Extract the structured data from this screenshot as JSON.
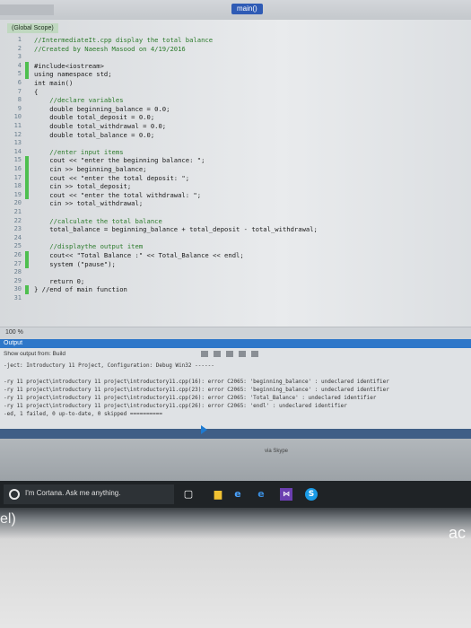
{
  "top": {
    "tab": "main()"
  },
  "editor": {
    "scope": "(Global Scope)",
    "lines": [
      {
        "n": "1",
        "code": "//IntermediateIt.cpp display the total balance"
      },
      {
        "n": "2",
        "code": "//Created by Naeesh Masood on 4/19/2016"
      },
      {
        "n": "3",
        "code": ""
      },
      {
        "n": "4",
        "code": "#include<iostream>"
      },
      {
        "n": "5",
        "code": "using namespace std;"
      },
      {
        "n": "6",
        "code": "int main()"
      },
      {
        "n": "7",
        "code": "{"
      },
      {
        "n": "8",
        "code": "    //declare variables"
      },
      {
        "n": "9",
        "code": "    double beginning_balance = 0.0;"
      },
      {
        "n": "10",
        "code": "    double total_deposit = 0.0;"
      },
      {
        "n": "11",
        "code": "    double total_withdrawal = 0.0;"
      },
      {
        "n": "12",
        "code": "    double total_balance = 0.0;"
      },
      {
        "n": "13",
        "code": ""
      },
      {
        "n": "14",
        "code": "    //enter input items"
      },
      {
        "n": "15",
        "code": "    cout << \"enter the beginning balance: \";"
      },
      {
        "n": "16",
        "code": "    cin >> beginning_balance;"
      },
      {
        "n": "17",
        "code": "    cout << \"enter the total deposit: \";"
      },
      {
        "n": "18",
        "code": "    cin >> total_deposit;"
      },
      {
        "n": "19",
        "code": "    cout << \"enter the total withdrawal: \";"
      },
      {
        "n": "20",
        "code": "    cin >> total_withdrawal;"
      },
      {
        "n": "21",
        "code": ""
      },
      {
        "n": "22",
        "code": "    //calculate the total balance"
      },
      {
        "n": "23",
        "code": "    total_balance = beginning_balance + total_deposit - total_withdrawal;"
      },
      {
        "n": "24",
        "code": ""
      },
      {
        "n": "25",
        "code": "    //displaythe output item"
      },
      {
        "n": "26",
        "code": "    cout<< \"Total Balance :\" << Total_Balance << endl;"
      },
      {
        "n": "27",
        "code": "    system (\"pause\");"
      },
      {
        "n": "28",
        "code": ""
      },
      {
        "n": "29",
        "code": "    return 0;"
      },
      {
        "n": "30",
        "code": "} //end of main function"
      },
      {
        "n": "31",
        "code": ""
      }
    ]
  },
  "zoom": "100 %",
  "output": {
    "title": "Output",
    "show_from": "Show output from:  Build",
    "lines": [
      "-ject: Introductory 11 Project, Configuration: Debug Win32 ------",
      "",
      "-ry 11 project\\introductory 11 project\\introductory11.cpp(16): error C2065: 'beginning_balance' : undeclared identifier",
      "-ry 11 project\\introductory 11 project\\introductory11.cpp(23): error C2065: 'beginning_balance' : undeclared identifier",
      "-ry 11 project\\introductory 11 project\\introductory11.cpp(26): error C2065: 'Total_Balance' : undeclared identifier",
      "-ry 11 project\\introductory 11 project\\introductory11.cpp(26): error C2065: 'endl' : undeclared identifier",
      "-ed, 1 failed, 0 up-to-date, 0 skipped =========="
    ]
  },
  "lower": {
    "via": "via Skype"
  },
  "taskbar": {
    "cortana": "I'm Cortana. Ask me anything."
  },
  "bottom": {
    "left_text": "el)",
    "right_text": "ac"
  }
}
